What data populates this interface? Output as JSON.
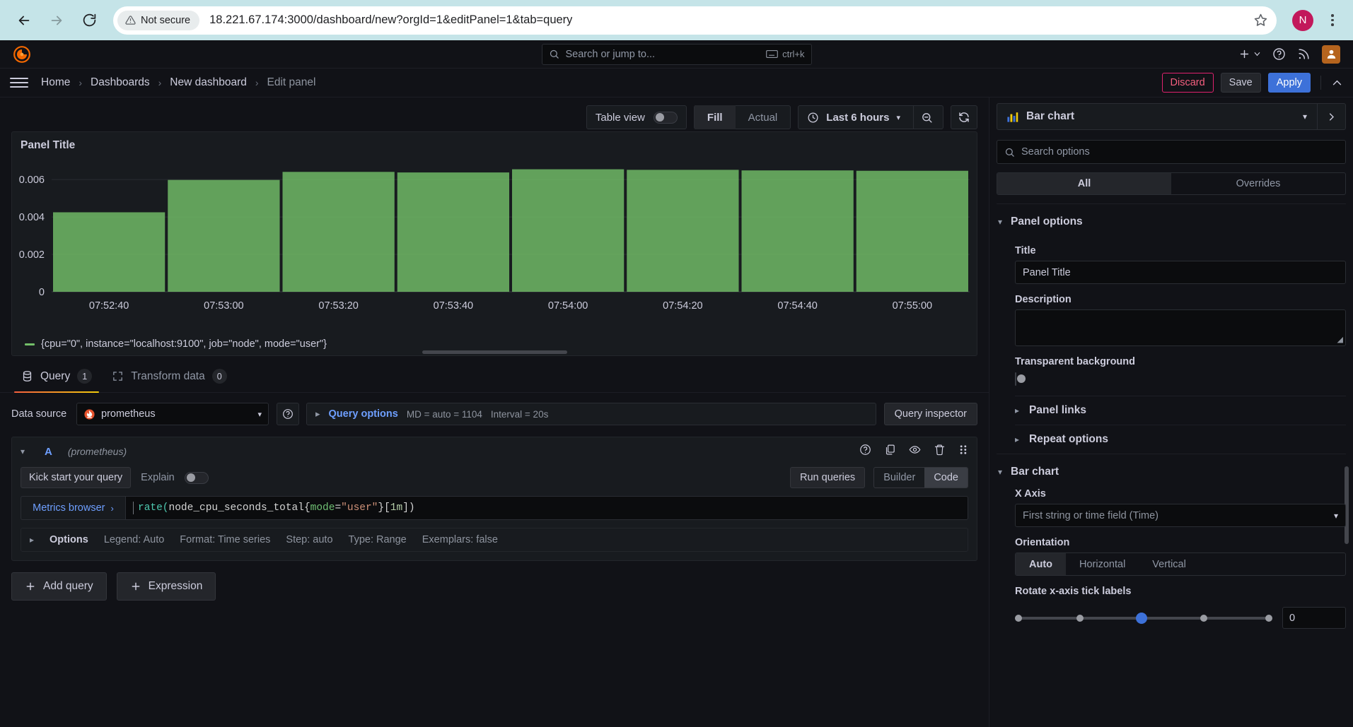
{
  "browser": {
    "security_label": "Not secure",
    "url": "18.221.67.174:3000/dashboard/new?orgId=1&editPanel=1&tab=query",
    "profile_initial": "N"
  },
  "topnav": {
    "search_placeholder": "Search or jump to...",
    "shortcut": "ctrl+k"
  },
  "breadcrumbs": {
    "items": [
      {
        "label": "Home"
      },
      {
        "label": "Dashboards"
      },
      {
        "label": "New dashboard"
      },
      {
        "label": "Edit panel"
      }
    ],
    "separator": "›",
    "discard_label": "Discard",
    "save_label": "Save",
    "apply_label": "Apply"
  },
  "toolbar": {
    "table_view_label": "Table view",
    "table_view_on": false,
    "fill_label": "Fill",
    "actual_label": "Actual",
    "fill_active": true,
    "time_range": "Last 6 hours"
  },
  "panel": {
    "title": "Panel Title",
    "legend": "{cpu=\"0\", instance=\"localhost:9100\", job=\"node\", mode=\"user\"}",
    "series_color": "#73bf69"
  },
  "chart_data": {
    "type": "bar",
    "title": "Panel Title",
    "xlabel": "",
    "ylabel": "",
    "categories": [
      "07:52:40",
      "07:53:00",
      "07:53:20",
      "07:53:40",
      "07:54:00",
      "07:54:20",
      "07:54:40",
      "07:55:00"
    ],
    "values": [
      0.00425,
      0.00598,
      0.00641,
      0.00638,
      0.00655,
      0.00652,
      0.00649,
      0.00647
    ],
    "series": [
      {
        "name": "{cpu=\"0\", instance=\"localhost:9100\", job=\"node\", mode=\"user\"}",
        "color": "#73bf69",
        "values": [
          0.00425,
          0.00598,
          0.00641,
          0.00638,
          0.00655,
          0.00652,
          0.00649,
          0.00647
        ]
      }
    ],
    "yticks": [
      0,
      0.002,
      0.004,
      0.006
    ],
    "yticklabels": [
      "0",
      "0.002",
      "0.004",
      "0.006"
    ],
    "ylim": [
      0,
      0.00695
    ],
    "grid": true,
    "legend_position": "bottom"
  },
  "query_tabs": [
    {
      "label": "Query",
      "count": "1",
      "active": true
    },
    {
      "label": "Transform data",
      "count": "0",
      "active": false
    }
  ],
  "query": {
    "datasource_label": "Data source",
    "datasource_name": "prometheus",
    "query_options_label": "Query options",
    "max_data_points": "MD = auto = 1104",
    "interval": "Interval = 20s",
    "query_inspector_label": "Query inspector",
    "ref_id": "A",
    "ref_datasource": "(prometheus)",
    "kick_start_label": "Kick start your query",
    "explain_label": "Explain",
    "explain_on": false,
    "run_queries_label": "Run queries",
    "builder_label": "Builder",
    "code_label": "Code",
    "mode_active": "Code",
    "metrics_browser_label": "Metrics browser",
    "expr_tokens": [
      {
        "t": "rate(",
        "c": "fn"
      },
      {
        "t": "node_cpu_seconds_total{",
        "c": "metric"
      },
      {
        "t": "mode",
        "c": "lbl"
      },
      {
        "t": "=",
        "c": "p"
      },
      {
        "t": "\"user\"",
        "c": "str"
      },
      {
        "t": "}[",
        "c": "p"
      },
      {
        "t": "1m",
        "c": "dur"
      },
      {
        "t": "])",
        "c": "p"
      }
    ],
    "options_label": "Options",
    "options_summary": [
      "Legend: Auto",
      "Format: Time series",
      "Step: auto",
      "Type: Range",
      "Exemplars: false"
    ],
    "add_query_label": "Add query",
    "expression_label": "Expression"
  },
  "options_sidebar": {
    "viz_name": "Bar chart",
    "search_placeholder": "Search options",
    "tab_all": "All",
    "tab_overrides": "Overrides",
    "panel_options_title": "Panel options",
    "title_label": "Title",
    "title_value": "Panel Title",
    "description_label": "Description",
    "description_value": "",
    "transparent_label": "Transparent background",
    "transparent_on": false,
    "panel_links_label": "Panel links",
    "repeat_options_label": "Repeat options",
    "barchart_title": "Bar chart",
    "x_axis_label": "X Axis",
    "x_axis_value": "First string or time field (Time)",
    "orientation_label": "Orientation",
    "orientation_options": [
      "Auto",
      "Horizontal",
      "Vertical"
    ],
    "orientation_active": "Auto",
    "rotate_label": "Rotate x-axis tick labels",
    "rotate_value": "0"
  }
}
